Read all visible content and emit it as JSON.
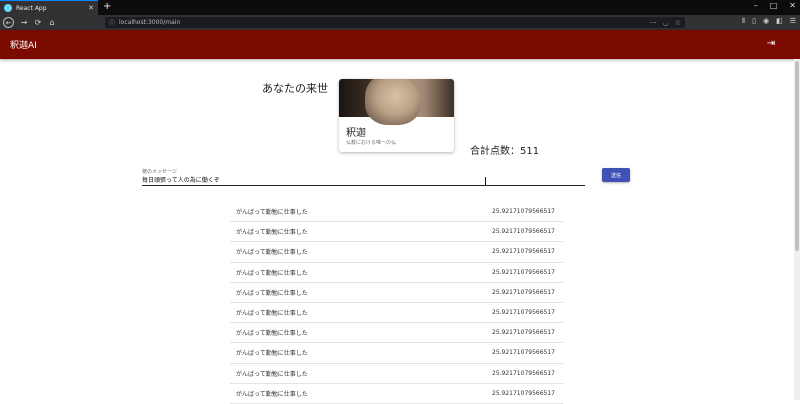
{
  "browser": {
    "tab_title": "React App",
    "tab_close": "✕",
    "new_tab": "+",
    "url": "localhost:3000/main",
    "back": "←",
    "forward": "→",
    "reload": "⟳",
    "home": "⌂",
    "menu": "☰"
  },
  "app": {
    "title": "釈迦AI",
    "logout_icon": "⇥"
  },
  "result": {
    "heading": "あなたの来世",
    "card_title": "釈迦",
    "card_subtitle": "仏教における唯一の仏",
    "score_label": "合計点数：511"
  },
  "form": {
    "label": "徳のメッセージ",
    "value": "毎日頑張って人の為に働くぞ",
    "submit_label": "送信"
  },
  "list": {
    "items": [
      {
        "text": "がんばって勤勉に仕事した",
        "score": "25.92171079566517"
      },
      {
        "text": "がんばって勤勉に仕事した",
        "score": "25.92171079566517"
      },
      {
        "text": "がんばって勤勉に仕事した",
        "score": "25.92171079566517"
      },
      {
        "text": "がんばって勤勉に仕事した",
        "score": "25.92171079566517"
      },
      {
        "text": "がんばって勤勉に仕事した",
        "score": "25.92171079566517"
      },
      {
        "text": "がんばって勤勉に仕事した",
        "score": "25.92171079566517"
      },
      {
        "text": "がんばって勤勉に仕事した",
        "score": "25.92171079566517"
      },
      {
        "text": "がんばって勤勉に仕事した",
        "score": "25.92171079566517"
      },
      {
        "text": "がんばって勤勉に仕事した",
        "score": "25.92171079566517"
      },
      {
        "text": "がんばって勤勉に仕事した",
        "score": "25.92171079566517"
      }
    ]
  },
  "colors": {
    "appbar": "#7b0b00",
    "button": "#3f51b5"
  }
}
